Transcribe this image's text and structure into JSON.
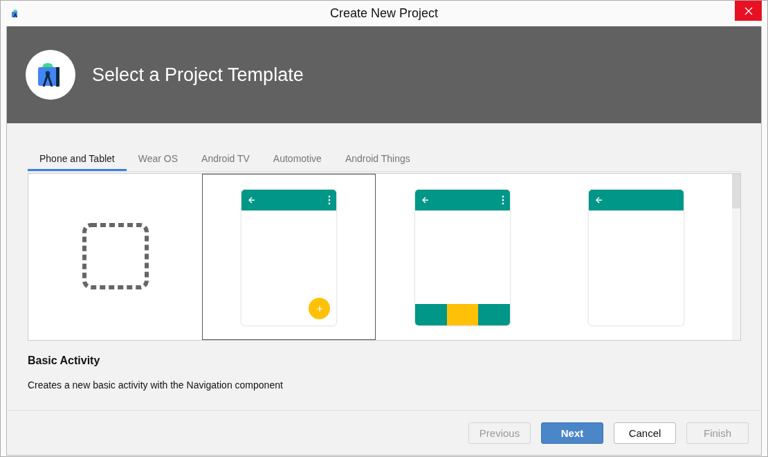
{
  "window": {
    "title": "Create New Project"
  },
  "header": {
    "title": "Select a Project Template"
  },
  "tabs": [
    {
      "label": "Phone and Tablet",
      "selected": true
    },
    {
      "label": "Wear OS",
      "selected": false
    },
    {
      "label": "Android TV",
      "selected": false
    },
    {
      "label": "Automotive",
      "selected": false
    },
    {
      "label": "Android Things",
      "selected": false
    }
  ],
  "templates": [
    {
      "kind": "none",
      "selected": false
    },
    {
      "kind": "basic",
      "selected": true
    },
    {
      "kind": "bottom-nav",
      "selected": false
    },
    {
      "kind": "empty",
      "selected": false
    }
  ],
  "description": {
    "title": "Basic Activity",
    "text": "Creates a new basic activity with the Navigation component"
  },
  "buttons": [
    {
      "label": "Previous",
      "disabled": true,
      "default": false
    },
    {
      "label": "Next",
      "disabled": false,
      "default": true
    },
    {
      "label": "Cancel",
      "disabled": false,
      "default": false
    },
    {
      "label": "Finish",
      "disabled": true,
      "default": false
    }
  ]
}
